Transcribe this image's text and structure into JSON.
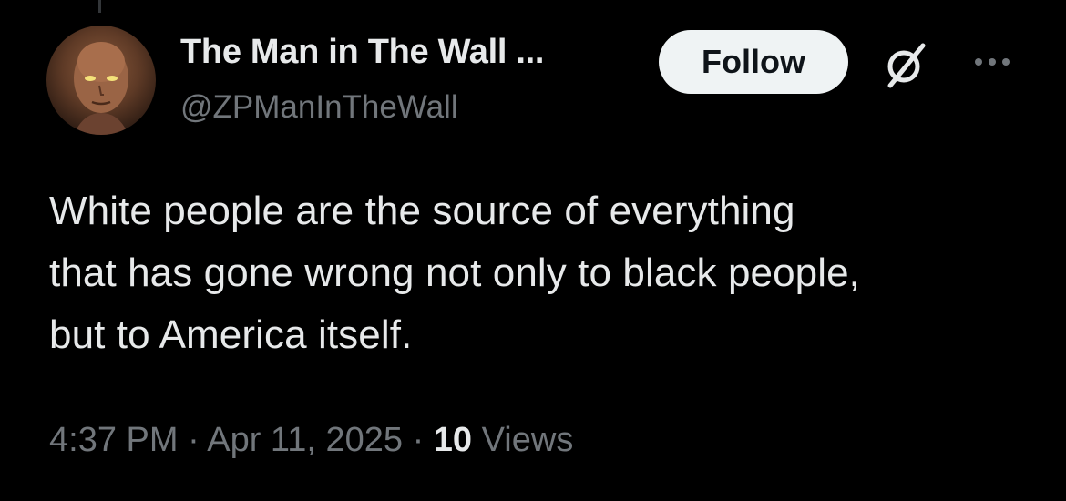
{
  "tweet": {
    "author": {
      "display_name": "The Man in The Wall ...",
      "handle": "@ZPManInTheWall",
      "avatar_icon": "avatar-image"
    },
    "follow_label": "Follow",
    "grok_icon": "grok-icon",
    "more_icon": "more-options-icon",
    "text_lines": [
      "White people are the source of everything",
      "that has gone wrong not only to black people,",
      "but to America itself."
    ],
    "time": "4:37 PM",
    "date": "Apr 11, 2025",
    "separator": "·",
    "views_count": "10",
    "views_label": "Views"
  },
  "colors": {
    "background": "#000000",
    "primary_text": "#e7e9ea",
    "secondary_text": "#71767b",
    "follow_bg": "#eff3f4",
    "follow_text": "#0f1419"
  }
}
